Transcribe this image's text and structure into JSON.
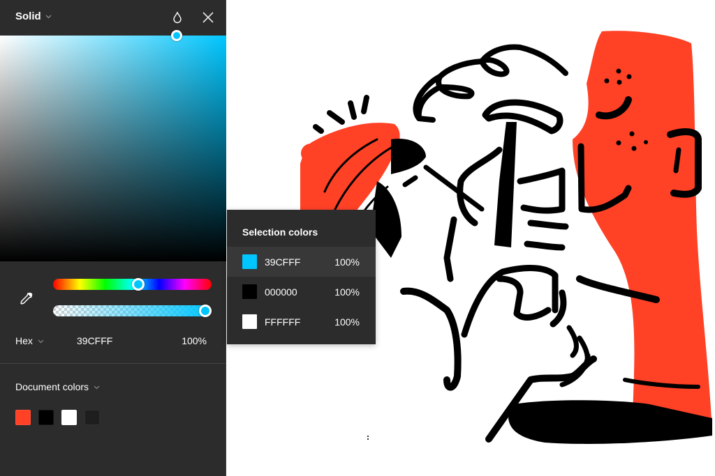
{
  "picker": {
    "mode": "Solid",
    "icons": {
      "mode_chevron": "chevron-down-icon",
      "drop": "droplet-icon",
      "close": "close-icon",
      "eyedropper": "eyedropper-icon"
    },
    "current_color": "#00C6FF",
    "hue_position_fraction": 0.54,
    "alpha_position_fraction": 1.0,
    "format": "Hex",
    "hex_value": "39CFFF",
    "opacity_value": "100%"
  },
  "document_colors": {
    "label": "Document colors",
    "swatches": [
      {
        "name": "orange-red",
        "color": "#FF4126"
      },
      {
        "name": "black",
        "color": "#000000"
      },
      {
        "name": "white",
        "color": "#FFFFFF"
      },
      {
        "name": "dark-gray",
        "color": "#1E1E1E"
      }
    ]
  },
  "selection_colors": {
    "title": "Selection colors",
    "rows": [
      {
        "hex": "39CFFF",
        "opacity": "100%",
        "color": "#00C6FF",
        "active": true
      },
      {
        "hex": "000000",
        "opacity": "100%",
        "color": "#000000",
        "active": false
      },
      {
        "hex": "FFFFFF",
        "opacity": "100%",
        "color": "#FFFFFF",
        "active": false
      }
    ]
  },
  "illustration": {
    "description": "Hand-drawn illustration: figure with orange-red beret holding a razor, and tall orange-red smiling head",
    "colors": {
      "accent": "#FF4126",
      "ink": "#000000",
      "paper": "#FFFFFF"
    }
  }
}
